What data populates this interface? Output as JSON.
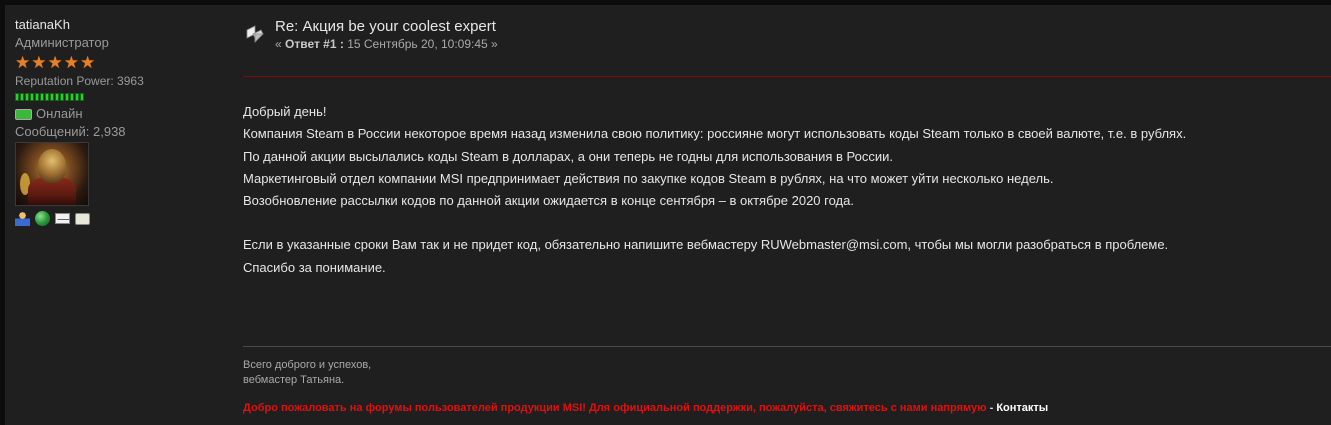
{
  "poster": {
    "username": "tatianaKh",
    "role": "Администратор",
    "stars": 5,
    "reputation": "Reputation Power: 3963",
    "reputation_pips": 14,
    "status": "Онлайн",
    "post_count": "Сообщений: 2,938",
    "profile_icons": [
      "profile-icon",
      "website-icon",
      "email-icon",
      "pm-icon"
    ]
  },
  "post": {
    "title": "Re: Акция be your coolest expert",
    "meta_prefix": "« ",
    "meta_reply": "Ответ #1 :",
    "meta_date": " 15 Сентябрь 20, 10:09:45 »",
    "lines": [
      "Добрый день!",
      "Компания Steam в России некоторое время назад изменила свою политику: россияне могут использовать коды Steam только в своей валюте, т.е. в рублях.",
      "По данной акции высылались коды Steam в долларах, а они теперь не годны для использования в России.",
      "Маркетинговый отдел компании MSI предпринимает действия по закупке кодов Steam в рублях, на что может уйти несколько недель.",
      "Возобновление рассылки кодов по данной акции ожидается в конце сентября – в октябре 2020 года."
    ],
    "lines2": [
      "Если в указанные сроки Вам так и не придет код, обязательно напишите вебмастеру RUWebmaster@msi.com, чтобы мы могли разобраться в проблеме.",
      "Спасибо за понимание."
    ]
  },
  "signature": {
    "line1": "Всего доброго и успехов,",
    "line2": "вебмастер Татьяна."
  },
  "notice": {
    "text": "Добро пожаловать на форумы пользователей продукции MSI! Для официальной поддержки, пожалуйста, свяжитесь с нами напрямую",
    "separator": " - ",
    "link": "Контакты"
  },
  "colors": {
    "background": "#1f1f1f",
    "divider_red": "#7a0e0e",
    "notice_red": "#e01010",
    "star": "#e8802a",
    "reputation_green": "#2bd12b"
  }
}
